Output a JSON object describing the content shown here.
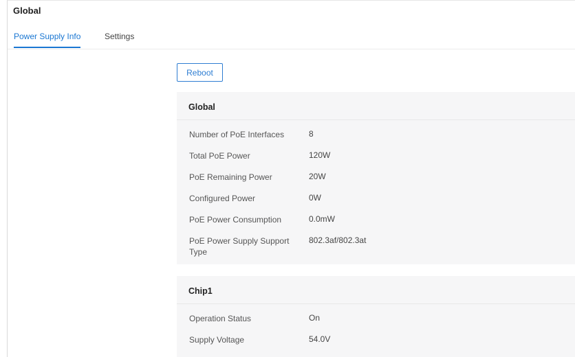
{
  "page": {
    "title": "Global"
  },
  "tabs": [
    {
      "label": "Power Supply Info",
      "active": true
    },
    {
      "label": "Settings",
      "active": false
    }
  ],
  "actions": {
    "reboot_label": "Reboot"
  },
  "global_panel": {
    "title": "Global",
    "rows": [
      {
        "label": "Number of PoE Interfaces",
        "value": "8"
      },
      {
        "label": "Total PoE Power",
        "value": "120W"
      },
      {
        "label": "PoE Remaining Power",
        "value": "20W"
      },
      {
        "label": "Configured Power",
        "value": "0W"
      },
      {
        "label": "PoE Power Consumption",
        "value": "0.0mW"
      },
      {
        "label": "PoE Power Supply Support Type",
        "value": "802.3af/802.3at"
      }
    ]
  },
  "chip_panel": {
    "title": "Chip1",
    "rows": [
      {
        "label": "Operation Status",
        "value": "On"
      },
      {
        "label": "Supply Voltage",
        "value": "54.0V"
      }
    ]
  },
  "colors": {
    "accent": "#1976d2",
    "panel_bg": "#f6f6f7"
  }
}
